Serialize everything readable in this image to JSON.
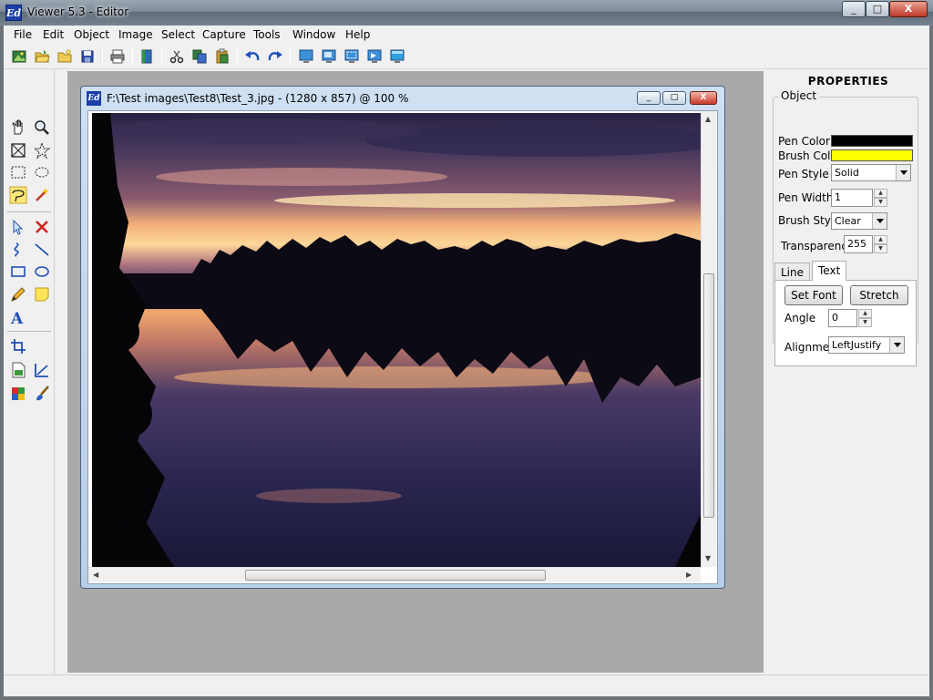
{
  "window": {
    "title": "Viewer 5.3 - Editor",
    "icon": "Ed",
    "controls": {
      "minimize": "_",
      "maximize": "□",
      "close": "X"
    }
  },
  "menu": [
    "File",
    "Edit",
    "Object",
    "Image",
    "Select",
    "Capture",
    "Tools",
    "Window",
    "Help"
  ],
  "toolbar": [
    "open-image-icon",
    "open-folder-icon",
    "folder-icon",
    "save-icon",
    "print-icon",
    "book-icon",
    "cut-icon",
    "copy-icon",
    "paste-icon",
    "undo-icon",
    "redo-icon",
    "monitor-icon",
    "monitor-window-icon",
    "monitor-region-icon",
    "monitor-object-icon",
    "monitor-screen-icon"
  ],
  "tools": [
    "hand-icon",
    "zoom-icon",
    "crop-select-icon",
    "star-select-icon",
    "rect-select-icon",
    "ellipse-select-icon",
    "lasso-icon",
    "magic-wand-icon",
    "pointer-icon",
    "delete-icon",
    "curve-icon",
    "line-icon",
    "rectangle-icon",
    "ellipse-icon",
    "pencil-icon",
    "note-icon",
    "text-icon",
    "crop-icon",
    "image-object-icon",
    "measure-icon",
    "color-palette-icon",
    "brush-icon"
  ],
  "child_window": {
    "title": "F:\\Test images\\Test8\\Test_3.jpg - (1280 x 857) @ 100 %",
    "icon": "Ed",
    "controls": {
      "minimize": "_",
      "maximize": "□",
      "close": "X"
    },
    "image": "sunset-lake-photo"
  },
  "properties": {
    "title": "PROPERTIES",
    "group": "Object",
    "pen_color_label": "Pen Color",
    "pen_color": "#000000",
    "brush_color_label": "Brush Color",
    "brush_color": "#ffff00",
    "pen_style_label": "Pen Style",
    "pen_style": "Solid",
    "pen_width_label": "Pen Width",
    "pen_width": "1",
    "brush_style_label": "Brush Style",
    "brush_style": "Clear",
    "transparency_label": "Transparency",
    "transparency": "255",
    "tabs": [
      "Line",
      "Text"
    ],
    "active_tab": "Text",
    "set_font_label": "Set Font",
    "stretch_label": "Stretch",
    "angle_label": "Angle",
    "angle": "0",
    "alignment_label": "Alignment",
    "alignment": "LeftJustify"
  },
  "colors": {
    "workspace": "#a9a9a9",
    "accent": "#1a3fa8"
  }
}
